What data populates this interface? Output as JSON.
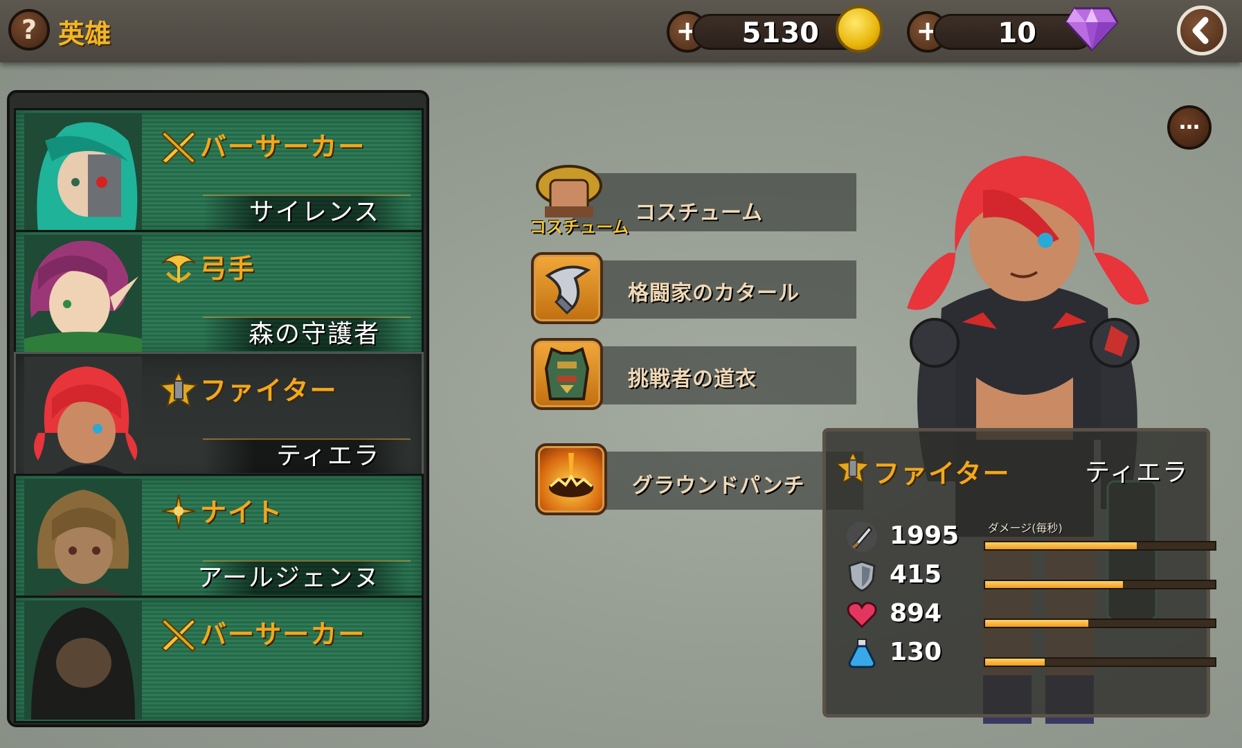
{
  "topbar": {
    "title": "英雄",
    "help_label": "?",
    "gold_amount": "5130",
    "gem_amount": "10",
    "plus_label": "+"
  },
  "hero_list": [
    {
      "class": "バーサーカー",
      "name": "サイレンス",
      "selected": false
    },
    {
      "class": "弓手",
      "name": "森の守護者",
      "selected": false
    },
    {
      "class": "ファイター",
      "name": "ティエラ",
      "selected": true
    },
    {
      "class": "ナイト",
      "name": "アールジェンヌ",
      "selected": false
    },
    {
      "class": "バーサーカー",
      "name": "",
      "selected": false
    }
  ],
  "equipment": {
    "costume_caption": "コスチューム",
    "items": [
      {
        "label": "コスチューム",
        "icon": "costume-icon"
      },
      {
        "label": "格闘家のカタール",
        "icon": "katar-claw-icon"
      },
      {
        "label": "挑戦者の道衣",
        "icon": "armor-vest-icon"
      },
      {
        "label": "グラウンドパンチ",
        "icon": "ground-punch-skill-icon"
      }
    ]
  },
  "more_label": "…",
  "stats": {
    "class": "ファイター",
    "name": "ティエラ",
    "rows": [
      {
        "icon": "sword-icon",
        "value": "1995",
        "caption": "ダメージ(毎秒)",
        "fill": 0.66
      },
      {
        "icon": "shield-icon",
        "value": "415",
        "caption": "",
        "fill": 0.6
      },
      {
        "icon": "heart-icon",
        "value": "894",
        "caption": "",
        "fill": 0.45
      },
      {
        "icon": "mana-potion-icon",
        "value": "130",
        "caption": "",
        "fill": 0.26
      }
    ]
  },
  "colors": {
    "accent_orange": "#f2a81d",
    "card_green": "#2e7a55",
    "bar_fill": "#f29c1f"
  }
}
